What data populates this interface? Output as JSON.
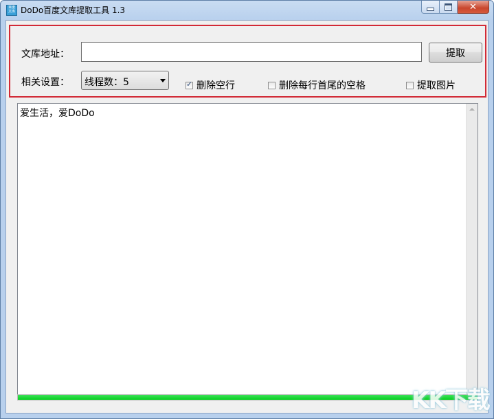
{
  "window": {
    "title": "DoDo百度文库提取工具  1.3"
  },
  "app_icon": {
    "name": "app-icon",
    "text": "百度文库"
  },
  "caption_buttons": [
    "minimize-icon",
    "maximize-icon",
    "close-icon"
  ],
  "settings": {
    "url_label": "文库地址：",
    "url_value": "",
    "extract_button": "提取",
    "settings_label": "相关设置：",
    "threads_select": {
      "selected": "线程数：5"
    },
    "checkboxes": [
      {
        "label": "删除空行",
        "checked": true
      },
      {
        "label": "删除每行首尾的空格",
        "checked": false
      },
      {
        "label": "提取图片",
        "checked": false
      }
    ]
  },
  "output": {
    "text": "爱生活，爱DoDo"
  },
  "progress": {
    "percent": 100,
    "color": "#06d01f"
  },
  "accent": {
    "settings_border": "#d22a36"
  },
  "watermark": {
    "text": "KK下载"
  }
}
